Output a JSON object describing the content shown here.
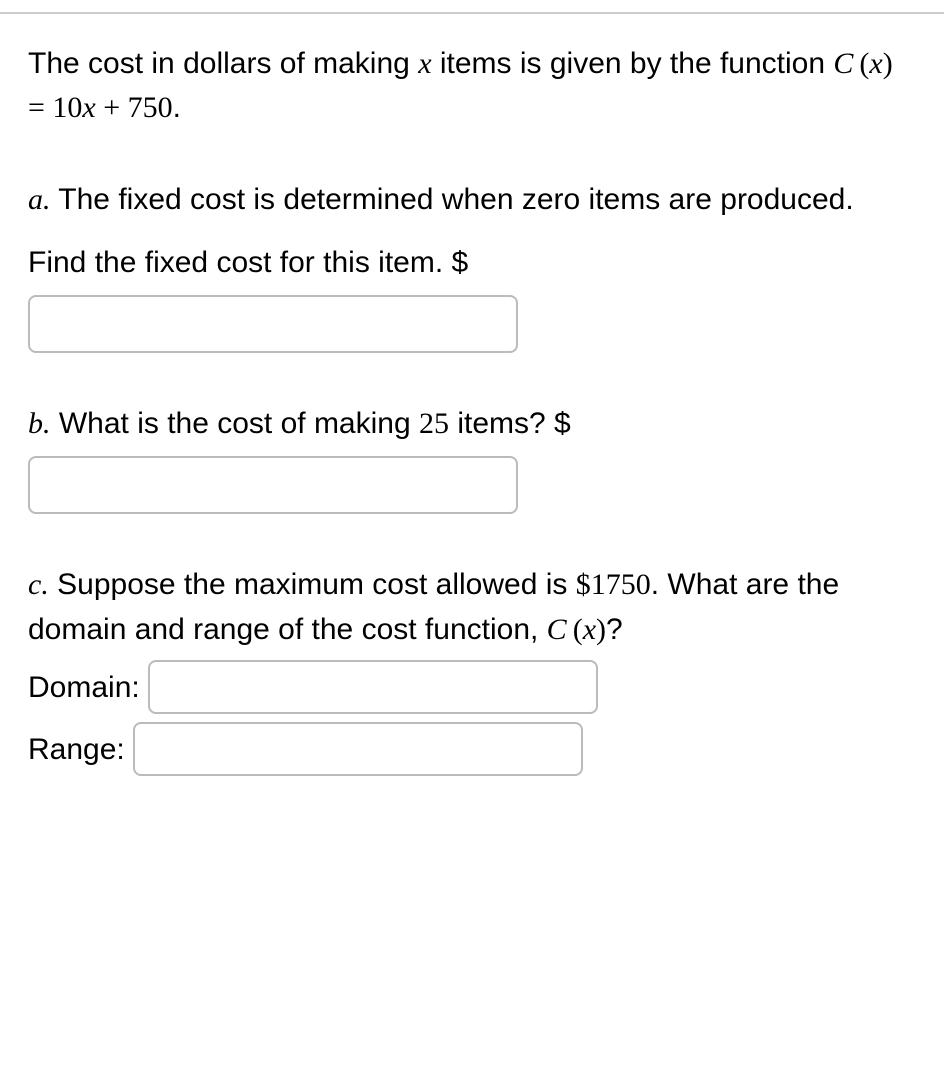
{
  "problem": {
    "intro_prefix": "The cost in dollars of making ",
    "intro_var": "x",
    "intro_suffix": " items is given by the function ",
    "func_lhs_C": "C",
    "func_lhs_paren_open": "(",
    "func_lhs_x": "x",
    "func_lhs_paren_close": ")",
    "func_eq": " = ",
    "func_rhs_coef": "10",
    "func_rhs_x": "x",
    "func_rhs_plus": " + ",
    "func_rhs_const": "750",
    "func_period": "."
  },
  "partA": {
    "label": "a.",
    "text1": " The fixed cost is determined when zero items are produced.",
    "text2": "Find the fixed cost for this item. $"
  },
  "partB": {
    "label": "b.",
    "text_prefix": " What is the cost of making ",
    "count": "25",
    "text_suffix": " items? $"
  },
  "partC": {
    "label": "c.",
    "text_prefix": " Suppose the maximum cost allowed is ",
    "max_cost": "$1750",
    "text_mid": ". What are the domain and range of the cost function, ",
    "func_C": "C",
    "func_paren_open": "(",
    "func_x": "x",
    "func_paren_close": ")",
    "text_q": "?",
    "domain_label": "Domain:",
    "range_label": "Range:"
  }
}
